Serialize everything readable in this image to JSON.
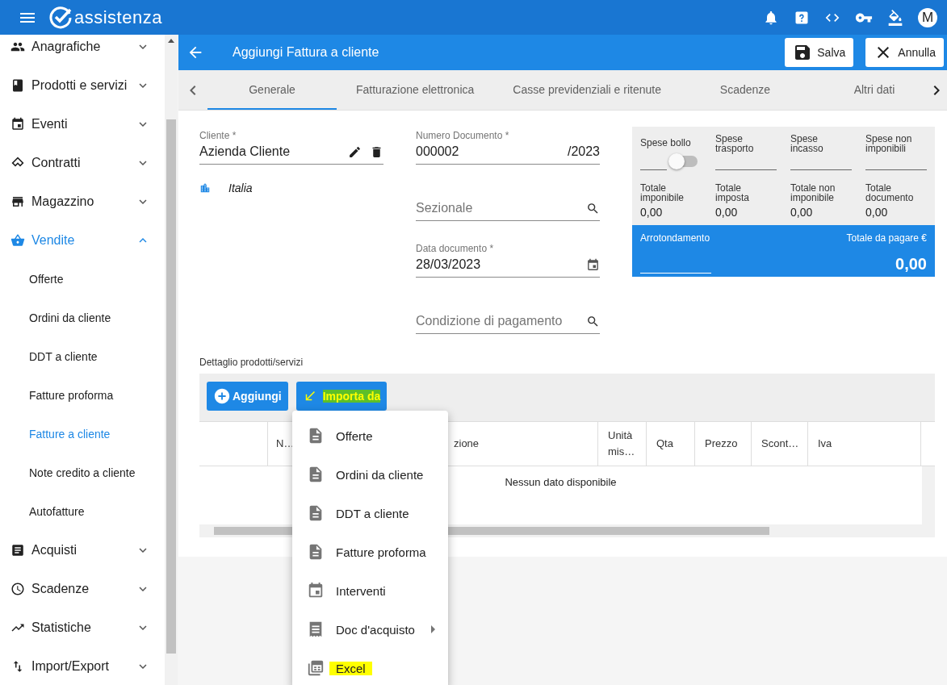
{
  "app": {
    "logo_text": "assistenza",
    "avatar": "M"
  },
  "sidebar": {
    "items": [
      {
        "label": "Anagrafiche",
        "expanded": false,
        "selected": false
      },
      {
        "label": "Prodotti e servizi",
        "expanded": false,
        "selected": false
      },
      {
        "label": "Eventi",
        "expanded": false,
        "selected": false
      },
      {
        "label": "Contratti",
        "expanded": false,
        "selected": false
      },
      {
        "label": "Magazzino",
        "expanded": false,
        "selected": false
      },
      {
        "label": "Vendite",
        "expanded": true,
        "selected": true,
        "children": [
          {
            "label": "Offerte",
            "selected": false
          },
          {
            "label": "Ordini da cliente",
            "selected": false
          },
          {
            "label": "DDT a cliente",
            "selected": false
          },
          {
            "label": "Fatture proforma",
            "selected": false
          },
          {
            "label": "Fatture a cliente",
            "selected": true
          },
          {
            "label": "Note credito a cliente",
            "selected": false
          },
          {
            "label": "Autofatture",
            "selected": false
          }
        ]
      },
      {
        "label": "Acquisti",
        "expanded": false,
        "selected": false
      },
      {
        "label": "Scadenze",
        "expanded": false,
        "selected": false
      },
      {
        "label": "Statistiche",
        "expanded": false,
        "selected": false
      },
      {
        "label": "Import/Export",
        "expanded": false,
        "selected": false
      }
    ]
  },
  "header": {
    "title": "Aggiungi Fattura a cliente",
    "buttons": [
      {
        "label": "Salva"
      },
      {
        "label": "Annulla"
      }
    ]
  },
  "tabs": [
    {
      "label": "Generale",
      "selected": true
    },
    {
      "label": "Fatturazione elettronica",
      "selected": false
    },
    {
      "label": "Casse previdenziali e ritenute",
      "selected": false
    },
    {
      "label": "Scadenze",
      "selected": false
    },
    {
      "label": "Altri dati",
      "selected": false
    }
  ],
  "form": {
    "cliente": {
      "label": "Cliente *",
      "value": "Azienda Cliente"
    },
    "country": "Italia",
    "numero": {
      "label": "Numero Documento *",
      "value": "000002",
      "suffix": "/2023"
    },
    "sezionale": {
      "placeholder": "Sezionale"
    },
    "data": {
      "label": "Data documento *",
      "value": "28/03/2023"
    },
    "condizione": {
      "placeholder": "Condizione di pagamento"
    }
  },
  "totals": {
    "spese": [
      {
        "label": "Spese bollo",
        "kind": "toggle",
        "on": false
      },
      {
        "label": "Spese trasporto",
        "kind": "field"
      },
      {
        "label": "Spese incasso",
        "kind": "field"
      },
      {
        "label": "Spese non imponibili",
        "kind": "field"
      }
    ],
    "totali": [
      {
        "label": "Totale imponibile",
        "value": "0,00"
      },
      {
        "label": "Totale imposta",
        "value": "0,00"
      },
      {
        "label": "Totale non imponibile",
        "value": "0,00"
      },
      {
        "label": "Totale documento",
        "value": "0,00"
      }
    ],
    "arrotondamento": {
      "label": "Arrotondamento"
    },
    "totale_da_pagare": {
      "label": "Totale da pagare €",
      "value": "0,00"
    }
  },
  "details": {
    "title": "Dettaglio prodotti/servizi",
    "buttons": [
      {
        "label": "Aggiungi",
        "highlighted": false
      },
      {
        "label": "Importa da",
        "highlighted": true
      }
    ],
    "table": {
      "columns": [
        {
          "label": "N…"
        },
        {
          "label": "zione"
        },
        {
          "label": "Unità mis…"
        },
        {
          "label": "Qta"
        },
        {
          "label": "Prezzo"
        },
        {
          "label": "Scont…"
        },
        {
          "label": "Iva"
        }
      ],
      "empty_message": "Nessun dato disponibile"
    }
  },
  "import_menu": {
    "items": [
      {
        "label": "Offerte",
        "submenu": false,
        "highlighted": false
      },
      {
        "label": "Ordini da cliente",
        "submenu": false,
        "highlighted": false
      },
      {
        "label": "DDT a cliente",
        "submenu": false,
        "highlighted": false
      },
      {
        "label": "Fatture proforma",
        "submenu": false,
        "highlighted": false
      },
      {
        "label": "Interventi",
        "submenu": false,
        "highlighted": false
      },
      {
        "label": "Doc d'acquisto",
        "submenu": true,
        "highlighted": false
      },
      {
        "label": "Excel",
        "submenu": false,
        "highlighted": true
      }
    ]
  }
}
